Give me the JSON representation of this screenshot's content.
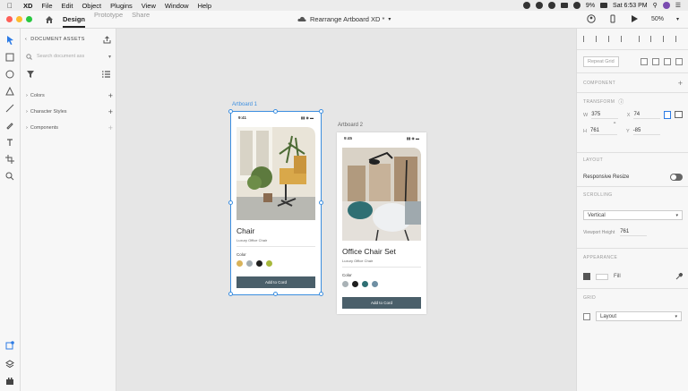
{
  "menubar": {
    "app": "XD",
    "items": [
      "File",
      "Edit",
      "Object",
      "Plugins",
      "View",
      "Window",
      "Help"
    ],
    "battery": "9%",
    "datetime": "Sat 6:53 PM"
  },
  "titlebar": {
    "tabs": [
      "Design",
      "Prototype",
      "Share"
    ],
    "document_title": "Rearrange Artboard XD *",
    "zoom": "50%"
  },
  "assets": {
    "header": "DOCUMENT ASSETS",
    "search_placeholder": "Search document ass",
    "sections": [
      "Colors",
      "Character Styles",
      "Components"
    ]
  },
  "canvas": {
    "artboard1": {
      "label": "Artboard 1",
      "time": "9:41",
      "title": "Chair",
      "subtitle": "Luxury Office Chair",
      "color_label": "Color",
      "swatches": [
        "#d9b35a",
        "#a4adb2",
        "#1f1f1f",
        "#a7b83c"
      ],
      "button": "Add to Cord"
    },
    "artboard2": {
      "label": "Artboard 2",
      "time": "9:45",
      "title": "Office Chair Set",
      "subtitle": "Luxury Office Chair",
      "color_label": "Color",
      "swatches": [
        "#a9b2b6",
        "#1f1f1f",
        "#2f6f73",
        "#6f8fa3"
      ],
      "button": "Add to Cord"
    }
  },
  "props": {
    "repeat_grid": "Repeat Grid",
    "component": "COMPONENT",
    "transform": "TRANSFORM",
    "w_label": "W",
    "w": "375",
    "x_label": "X",
    "x": "74",
    "h_label": "H",
    "h": "761",
    "y_label": "Y",
    "y": "-85",
    "layout": "LAYOUT",
    "responsive_resize": "Responsive Resize",
    "scrolling": "SCROLLING",
    "scroll_option": "Vertical",
    "viewport_height_label": "Viewport Height",
    "viewport_height": "761",
    "appearance": "APPEARANCE",
    "fill": "Fill",
    "grid": "GRID",
    "grid_option": "Layout"
  },
  "colors": {
    "selection": "#3d8fe0",
    "cta": "#4a5f6a"
  }
}
